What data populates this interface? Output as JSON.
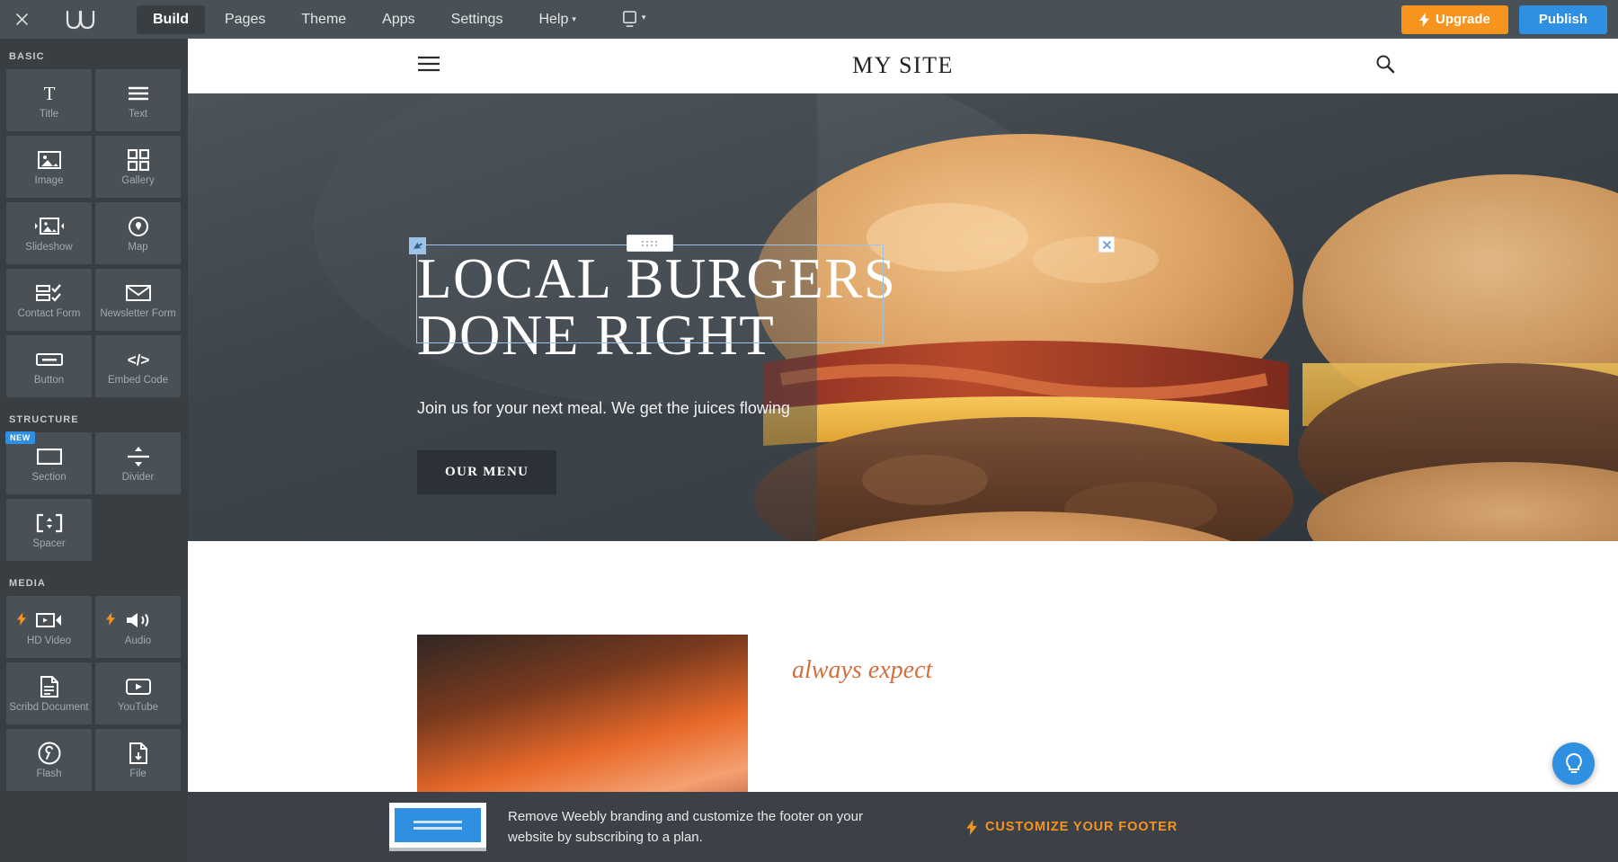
{
  "topbar": {
    "close_label": "close-editor",
    "logo_label": "Weebly",
    "nav": [
      {
        "label": "Build",
        "active": true
      },
      {
        "label": "Pages",
        "active": false
      },
      {
        "label": "Theme",
        "active": false
      },
      {
        "label": "Apps",
        "active": false
      },
      {
        "label": "Settings",
        "active": false
      },
      {
        "label": "Help",
        "active": false,
        "caret": "▾"
      }
    ],
    "device_caret": "▾",
    "upgrade_label": "Upgrade",
    "publish_label": "Publish",
    "colors": {
      "bar": "#4a5156",
      "upgrade": "#f7941e",
      "publish": "#2f8fe0"
    }
  },
  "sidebar": {
    "sections": [
      {
        "title": "BASIC",
        "tiles": [
          {
            "label": "Title",
            "icon": "title-icon"
          },
          {
            "label": "Text",
            "icon": "text-icon"
          },
          {
            "label": "Image",
            "icon": "image-icon"
          },
          {
            "label": "Gallery",
            "icon": "gallery-icon"
          },
          {
            "label": "Slideshow",
            "icon": "slideshow-icon"
          },
          {
            "label": "Map",
            "icon": "map-pin-icon"
          },
          {
            "label": "Contact Form",
            "icon": "contact-form-icon"
          },
          {
            "label": "Newsletter Form",
            "icon": "envelope-icon"
          },
          {
            "label": "Button",
            "icon": "button-icon"
          },
          {
            "label": "Embed Code",
            "icon": "code-icon"
          }
        ]
      },
      {
        "title": "STRUCTURE",
        "tiles": [
          {
            "label": "Section",
            "icon": "section-icon",
            "badge": "NEW"
          },
          {
            "label": "Divider",
            "icon": "divider-icon"
          },
          {
            "label": "Spacer",
            "icon": "spacer-icon"
          }
        ]
      },
      {
        "title": "MEDIA",
        "tiles": [
          {
            "label": "HD Video",
            "icon": "video-icon",
            "pro": true
          },
          {
            "label": "Audio",
            "icon": "audio-icon",
            "pro": true
          },
          {
            "label": "Scribd Document",
            "icon": "document-icon"
          },
          {
            "label": "YouTube",
            "icon": "youtube-icon"
          },
          {
            "label": "Flash",
            "icon": "wrench-icon"
          },
          {
            "label": "File",
            "icon": "file-download-icon"
          }
        ]
      }
    ]
  },
  "preview": {
    "site_header": {
      "title": "MY SITE",
      "menu_icon": "hamburger-icon",
      "search_icon": "search-icon"
    },
    "hero": {
      "title_line1": "LOCAL BURGERS",
      "title_line2": "DONE RIGHT",
      "subtitle": "Join us for your next meal. We get the juices flowing",
      "button_label": "OUR MENU"
    },
    "selection": {
      "move_icon": "move-arrow-icon",
      "drag_icon": "drag-dots-icon",
      "close_icon": "close-icon"
    },
    "lower": {
      "heading": "always expect"
    },
    "help_icon": "lightbulb-icon"
  },
  "footer_banner": {
    "thumb_label": "footer-preview-thumbnail",
    "message": "Remove Weebly branding and customize the footer on your website by subscribing to a plan.",
    "cta_label": "CUSTOMIZE YOUR FOOTER",
    "cta_color": "#f7941e"
  }
}
